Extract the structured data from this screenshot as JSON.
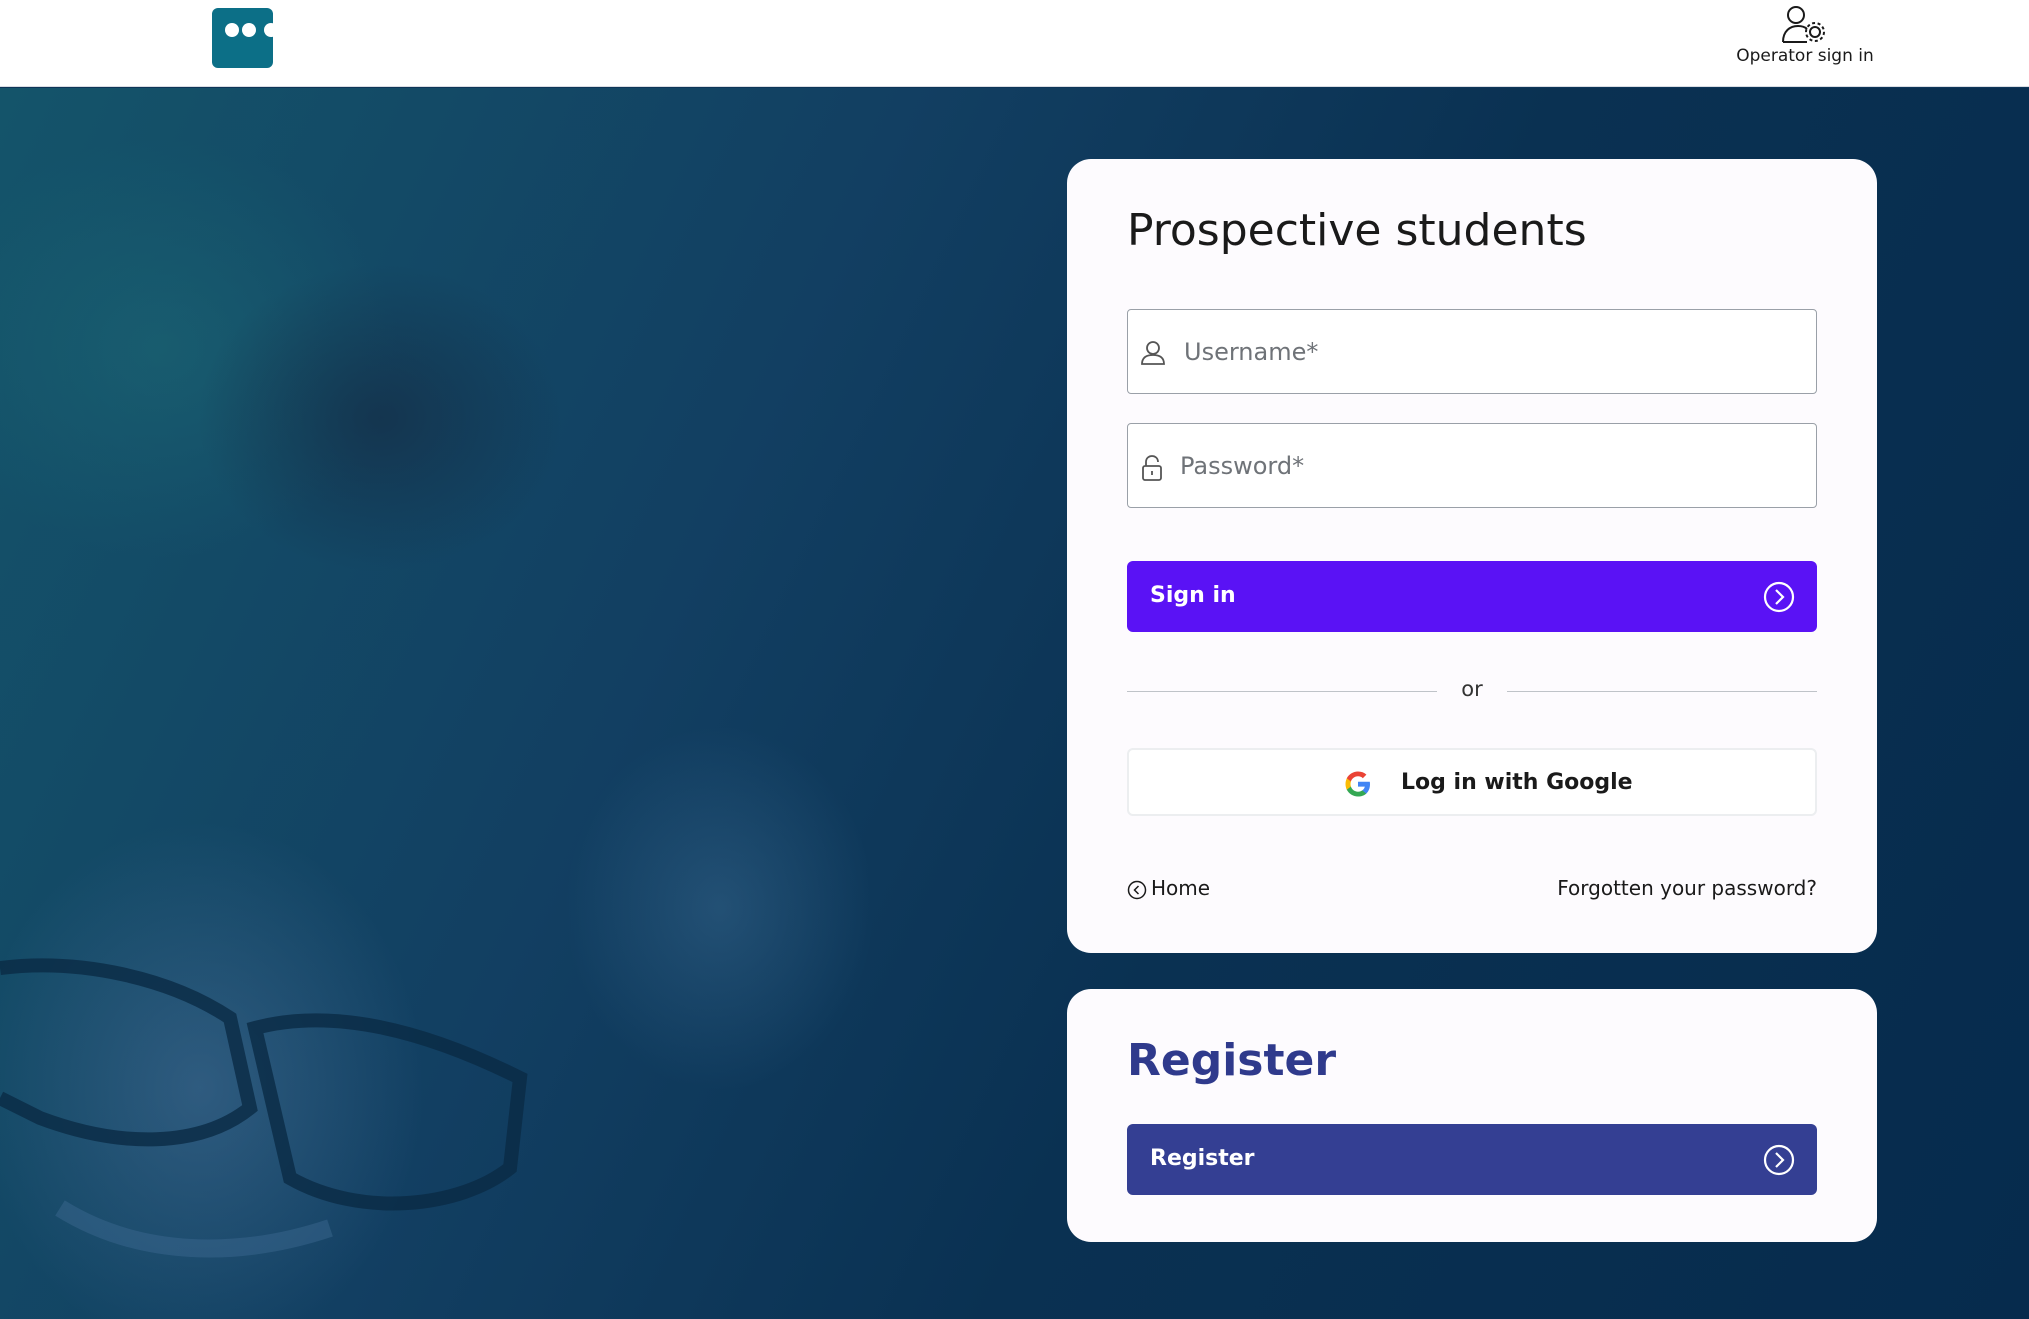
{
  "header": {
    "operator_label": "Operator sign in"
  },
  "login": {
    "title": "Prospective students",
    "username_placeholder": "Username*",
    "password_placeholder": "Password*",
    "signin_label": "Sign in",
    "divider_text": "or",
    "google_label": "Log in with Google",
    "home_label": "Home",
    "forgot_label": "Forgotten your password?"
  },
  "register": {
    "title": "Register",
    "button_label": "Register"
  },
  "colors": {
    "logo": "#0c6f87",
    "signin_button": "#5a12f5",
    "register_button": "#343f93",
    "register_title": "#2f3a8c",
    "background": "#0e3558"
  },
  "icons": {
    "operator": "user-gear-icon",
    "username": "user-icon",
    "password": "lock-icon",
    "arrow": "circle-chevron-right-icon",
    "google": "google-icon",
    "home": "circle-chevron-left-icon"
  }
}
